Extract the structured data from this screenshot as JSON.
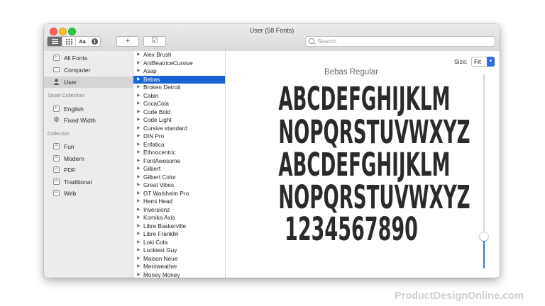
{
  "window": {
    "title": "User (58 Fonts)"
  },
  "toolbar": {
    "search_placeholder": "Search",
    "aa_label": "Aa",
    "info_label": "i",
    "add_label": "+",
    "check_label": "☑"
  },
  "sidebar": {
    "library_items": [
      {
        "label": "All Fonts",
        "icon": "font-library-icon"
      },
      {
        "label": "Computer",
        "icon": "computer-icon"
      },
      {
        "label": "User",
        "icon": "user-icon",
        "selected": true
      }
    ],
    "smart_collection_header": "Smart Collection",
    "smart_items": [
      {
        "label": "English",
        "icon": "font-collection-icon"
      },
      {
        "label": "Fixed Width",
        "icon": "gear-icon"
      }
    ],
    "collection_header": "Collection",
    "collection_items": [
      {
        "label": "Fun"
      },
      {
        "label": "Modern"
      },
      {
        "label": "PDF"
      },
      {
        "label": "Traditional"
      },
      {
        "label": "Web"
      }
    ],
    "add_label": "+"
  },
  "font_list": {
    "selected": "Bebas",
    "items": [
      "Alex Brush",
      "AniBeatriceCursive",
      "Asap",
      "Bebas",
      "Broken Detroit",
      "Cabin",
      "CocaCola",
      "Code Bold",
      "Code Light",
      "Cursive standard",
      "DIN Pro",
      "Enfatica",
      "Ethnocentric",
      "FontAwesome",
      "Gilbert",
      "Gilbert Color",
      "Great Vibes",
      "GT Walsheim Pro",
      "Hemi Head",
      "Inversionz",
      "Komika Axis",
      "Libre Baskerville",
      "Libre Franklin",
      "Loki Cola",
      "Luckiest Guy",
      "Maison Neue",
      "Merriweather",
      "Money Money"
    ]
  },
  "preview": {
    "size_label": "Size:",
    "size_value": "Fit",
    "slider_value_fraction": 0.17,
    "font_name": "Bebas Regular",
    "lines": [
      "ABCDEFGHIJKLM",
      "NOPQRSTUVWXYZ",
      "ABCDEFGHIJKLM",
      "NOPQRSTUVWXYZ",
      "1234567890"
    ]
  },
  "watermark": "ProductDesignOnline.com",
  "colors": {
    "selection": "#1a63d4",
    "accent": "#2d6fe0",
    "close": "#fd5f57",
    "minimize": "#febc2e",
    "maximize": "#28c840"
  }
}
